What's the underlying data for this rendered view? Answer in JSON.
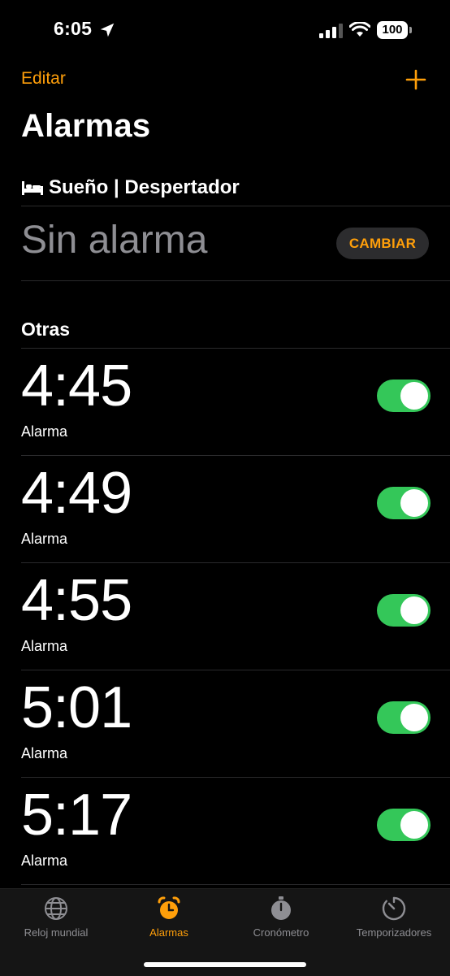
{
  "status": {
    "time": "6:05",
    "icons": [
      "location-arrow-icon",
      "cellular-signal-icon",
      "wifi-icon",
      "battery-icon"
    ],
    "battery": "100"
  },
  "nav": {
    "edit_label": "Editar",
    "add_icon": "plus-icon"
  },
  "page": {
    "title": "Alarmas"
  },
  "sleep": {
    "icon": "bed-icon",
    "header": "Sueño | Despertador",
    "status": "Sin alarma",
    "change_button": "CAMBIAR"
  },
  "others": {
    "header": "Otras",
    "alarms": [
      {
        "time": "4:45",
        "label": "Alarma",
        "enabled": true
      },
      {
        "time": "4:49",
        "label": "Alarma",
        "enabled": true
      },
      {
        "time": "4:55",
        "label": "Alarma",
        "enabled": true
      },
      {
        "time": "5:01",
        "label": "Alarma",
        "enabled": true
      },
      {
        "time": "5:17",
        "label": "Alarma",
        "enabled": true
      }
    ]
  },
  "tabbar": {
    "items": [
      {
        "label": "Reloj mundial",
        "icon": "globe-icon",
        "active": false
      },
      {
        "label": "Alarmas",
        "icon": "alarm-clock-icon",
        "active": true
      },
      {
        "label": "Cronómetro",
        "icon": "stopwatch-icon",
        "active": false
      },
      {
        "label": "Temporizadores",
        "icon": "timer-icon",
        "active": false
      }
    ]
  },
  "colors": {
    "accent": "#ff9f0a",
    "toggle_on": "#34c759",
    "background": "#000000",
    "secondary_text": "#8e8e93"
  }
}
